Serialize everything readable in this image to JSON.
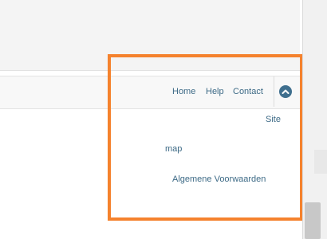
{
  "footer_nav": {
    "home": "Home",
    "help": "Help",
    "contact": "Contact"
  },
  "sitemap": {
    "line1": "Site",
    "line2": "map"
  },
  "terms": "Algemene Voorwaarden",
  "colors": {
    "link": "#3d6a86",
    "highlight": "#f5822d",
    "scroll_top_button": "#3f6f8e"
  },
  "icons": {
    "scroll_top": "chevron-up-icon"
  }
}
